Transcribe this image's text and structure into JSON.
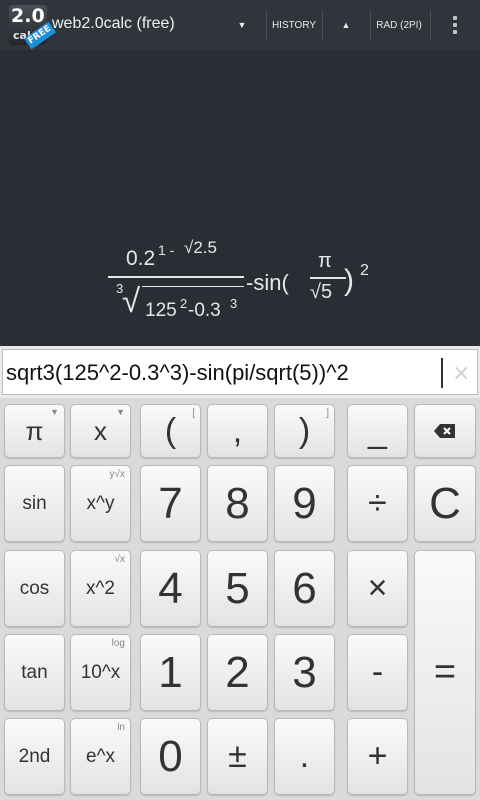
{
  "app": {
    "logo_number": "2.0",
    "logo_calc": "calc",
    "logo_badge": "FREE",
    "title": "web2.0calc (free)",
    "dropdown_glyph": "▼",
    "history_label": "HISTORY",
    "up_glyph": "▲",
    "mode_label": "RAD (2PI)"
  },
  "display": {
    "num_base": "0.2",
    "num_exp": "1 -",
    "num_root": "√2.5",
    "root_index": "3",
    "radical": "√",
    "under_root": "125",
    "under_exp1": "2",
    "under_minus": "-0.3",
    "under_exp2": "3",
    "minus_sin": "-sin(",
    "pi": "π",
    "sqrt5": "√5",
    "close": ")",
    "power": "2"
  },
  "input": {
    "expression": "sqrt3(125^2-0.3^3)-sin(pi/sqrt(5))^2",
    "clear_glyph": "×"
  },
  "keys": {
    "pi": "π",
    "x": "x",
    "lparen": "(",
    "lparen_alt": "[",
    "comma": ",",
    "rparen": ")",
    "rparen_alt": "]",
    "underscore": "_",
    "sin": "sin",
    "xy": "x^y",
    "xy_alt": "y√x",
    "seven": "7",
    "eight": "8",
    "nine": "9",
    "divide": "÷",
    "clear": "C",
    "cos": "cos",
    "x2": "x^2",
    "x2_alt": "√x",
    "four": "4",
    "five": "5",
    "six": "6",
    "multiply": "×",
    "tan": "tan",
    "tenx": "10^x",
    "tenx_alt": "log",
    "one": "1",
    "two": "2",
    "three": "3",
    "minus": "-",
    "equals": "=",
    "second": "2nd",
    "ex": "e^x",
    "ex_alt": "ln",
    "zero": "0",
    "plusminus": "±",
    "dot": ".",
    "plus": "+"
  }
}
